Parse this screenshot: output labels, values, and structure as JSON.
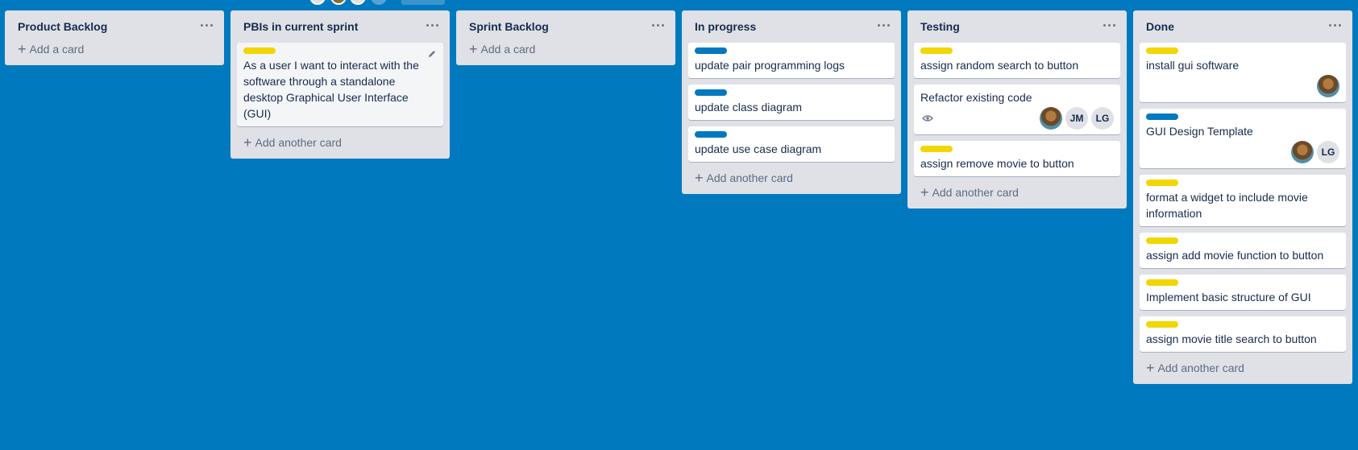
{
  "colors": {
    "board_background": "#0079bf",
    "list_background": "#dfe1e6",
    "label_yellow": "#f2d600",
    "label_blue": "#0079bf"
  },
  "lists": [
    {
      "title": "Product Backlog",
      "add_label": "Add a card",
      "cards": []
    },
    {
      "title": "PBIs in current sprint",
      "add_label": "Add another card",
      "cards": [
        {
          "label_color": "#f2d600",
          "title": "As a user I want to interact with the software through a standalone desktop Graphical User Interface (GUI)",
          "edit_icon": "pencil-icon",
          "members": []
        }
      ]
    },
    {
      "title": "Sprint Backlog",
      "add_label": "Add a card",
      "cards": []
    },
    {
      "title": "In progress",
      "add_label": "Add another card",
      "cards": [
        {
          "label_color": "#0079bf",
          "title": "update pair programming logs",
          "members": []
        },
        {
          "label_color": "#0079bf",
          "title": "update class diagram",
          "members": []
        },
        {
          "label_color": "#0079bf",
          "title": "update use case diagram",
          "members": []
        }
      ]
    },
    {
      "title": "Testing",
      "add_label": "Add another card",
      "cards": [
        {
          "label_color": "#f2d600",
          "title": "assign random search to button",
          "members": []
        },
        {
          "label_color": null,
          "title": "Refactor existing code",
          "watch_icon": "eye-icon",
          "members": [
            {
              "type": "photo"
            },
            {
              "type": "initials",
              "text": "JM"
            },
            {
              "type": "initials",
              "text": "LG"
            }
          ]
        },
        {
          "label_color": "#f2d600",
          "title": "assign remove movie to button",
          "members": []
        }
      ]
    },
    {
      "title": "Done",
      "add_label": "Add another card",
      "cards": [
        {
          "label_color": "#f2d600",
          "title": "install gui software",
          "members": [
            {
              "type": "photo"
            }
          ]
        },
        {
          "label_color": "#0079bf",
          "title": "GUI Design Template",
          "members": [
            {
              "type": "photo"
            },
            {
              "type": "initials",
              "text": "LG"
            }
          ]
        },
        {
          "label_color": "#f2d600",
          "title": "format a widget to include movie information",
          "members": []
        },
        {
          "label_color": "#f2d600",
          "title": "assign add movie function to button",
          "members": []
        },
        {
          "label_color": "#f2d600",
          "title": "Implement basic structure of GUI",
          "members": []
        },
        {
          "label_color": "#f2d600",
          "title": "assign movie title search to button",
          "members": []
        }
      ]
    }
  ]
}
